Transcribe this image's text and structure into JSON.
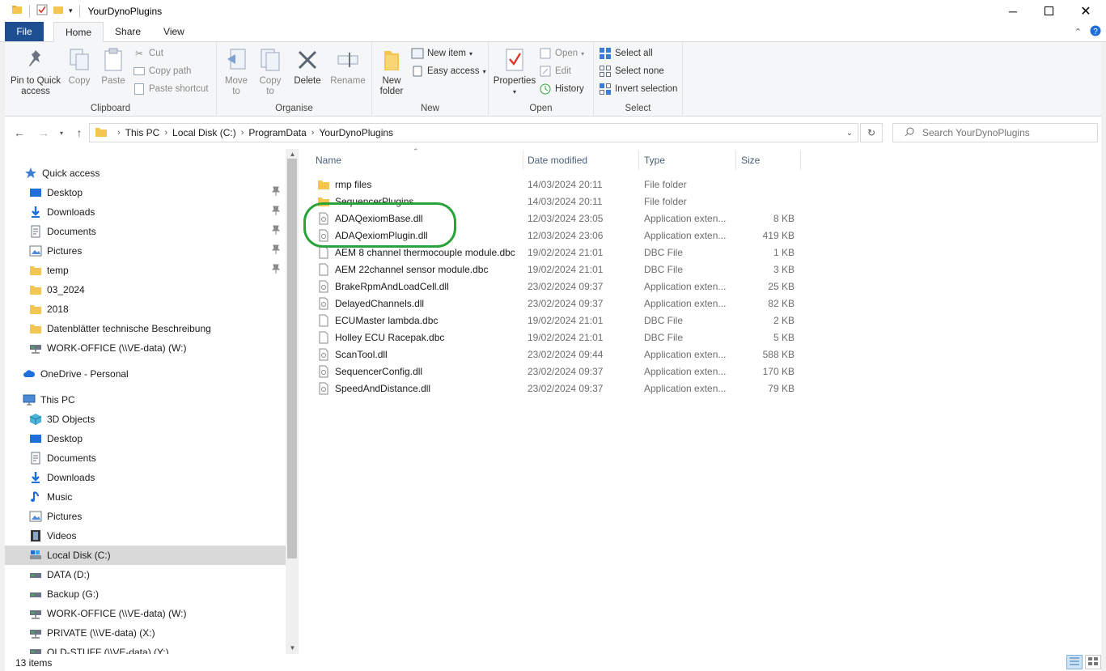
{
  "window": {
    "title": "YourDynoPlugins"
  },
  "ribbon_tabs": [
    "File",
    "Home",
    "Share",
    "View"
  ],
  "ribbon": {
    "clipboard": {
      "label": "Clipboard",
      "pin": "Pin to Quick\naccess",
      "copy": "Copy",
      "paste": "Paste",
      "cut": "Cut",
      "copy_path": "Copy path",
      "paste_shortcut": "Paste shortcut"
    },
    "organise": {
      "label": "Organise",
      "move_to": "Move\nto",
      "copy_to": "Copy\nto",
      "delete": "Delete",
      "rename": "Rename"
    },
    "new": {
      "label": "New",
      "new_folder": "New\nfolder",
      "new_item": "New item",
      "easy_access": "Easy access"
    },
    "open": {
      "label": "Open",
      "properties": "Properties",
      "open": "Open",
      "edit": "Edit",
      "history": "History"
    },
    "select": {
      "label": "Select",
      "select_all": "Select all",
      "select_none": "Select none",
      "invert": "Invert selection"
    }
  },
  "address": {
    "crumbs": [
      "This PC",
      "Local Disk (C:)",
      "ProgramData",
      "YourDynoPlugins"
    ],
    "search_placeholder": "Search YourDynoPlugins"
  },
  "nav": {
    "quick_access": "Quick access",
    "quick_items": [
      "Desktop",
      "Downloads",
      "Documents",
      "Pictures",
      "temp",
      "03_2024",
      "2018",
      "Datenblätter technische Beschreibung",
      "WORK-OFFICE (\\\\VE-data) (W:)"
    ],
    "onedrive": "OneDrive - Personal",
    "this_pc": "This PC",
    "pc_items": [
      "3D Objects",
      "Desktop",
      "Documents",
      "Downloads",
      "Music",
      "Pictures",
      "Videos",
      "Local Disk (C:)",
      "DATA (D:)",
      "Backup (G:)",
      "WORK-OFFICE (\\\\VE-data) (W:)",
      "PRIVATE (\\\\VE-data) (X:)",
      "OLD-STUFF (\\\\VE-data) (Y:)"
    ]
  },
  "columns": {
    "name": "Name",
    "date": "Date modified",
    "type": "Type",
    "size": "Size"
  },
  "files": [
    {
      "name": "rmp files",
      "date": "14/03/2024 20:11",
      "type": "File folder",
      "size": "",
      "kind": "folder"
    },
    {
      "name": "SequencerPlugins",
      "date": "14/03/2024 20:11",
      "type": "File folder",
      "size": "",
      "kind": "folder"
    },
    {
      "name": "ADAQexiomBase.dll",
      "date": "12/03/2024 23:05",
      "type": "Application exten...",
      "size": "8 KB",
      "kind": "dll"
    },
    {
      "name": "ADAQexiomPlugin.dll",
      "date": "12/03/2024 23:06",
      "type": "Application exten...",
      "size": "419 KB",
      "kind": "dll"
    },
    {
      "name": "AEM 8 channel thermocouple module.dbc",
      "date": "19/02/2024 21:01",
      "type": "DBC File",
      "size": "1 KB",
      "kind": "file"
    },
    {
      "name": "AEM 22channel sensor module.dbc",
      "date": "19/02/2024 21:01",
      "type": "DBC File",
      "size": "3 KB",
      "kind": "file"
    },
    {
      "name": "BrakeRpmAndLoadCell.dll",
      "date": "23/02/2024 09:37",
      "type": "Application exten...",
      "size": "25 KB",
      "kind": "dll"
    },
    {
      "name": "DelayedChannels.dll",
      "date": "23/02/2024 09:37",
      "type": "Application exten...",
      "size": "82 KB",
      "kind": "dll"
    },
    {
      "name": "ECUMaster lambda.dbc",
      "date": "19/02/2024 21:01",
      "type": "DBC File",
      "size": "2 KB",
      "kind": "file"
    },
    {
      "name": "Holley ECU Racepak.dbc",
      "date": "19/02/2024 21:01",
      "type": "DBC File",
      "size": "5 KB",
      "kind": "file"
    },
    {
      "name": "ScanTool.dll",
      "date": "23/02/2024 09:44",
      "type": "Application exten...",
      "size": "588 KB",
      "kind": "dll"
    },
    {
      "name": "SequencerConfig.dll",
      "date": "23/02/2024 09:37",
      "type": "Application exten...",
      "size": "170 KB",
      "kind": "dll"
    },
    {
      "name": "SpeedAndDistance.dll",
      "date": "23/02/2024 09:37",
      "type": "Application exten...",
      "size": "79 KB",
      "kind": "dll"
    }
  ],
  "status": {
    "count": "13 items"
  },
  "colors": {
    "file_tab": "#1e4f92",
    "folder": "#f4c551",
    "highlight": "#2aa33a",
    "selected": "#d9d9d9"
  }
}
